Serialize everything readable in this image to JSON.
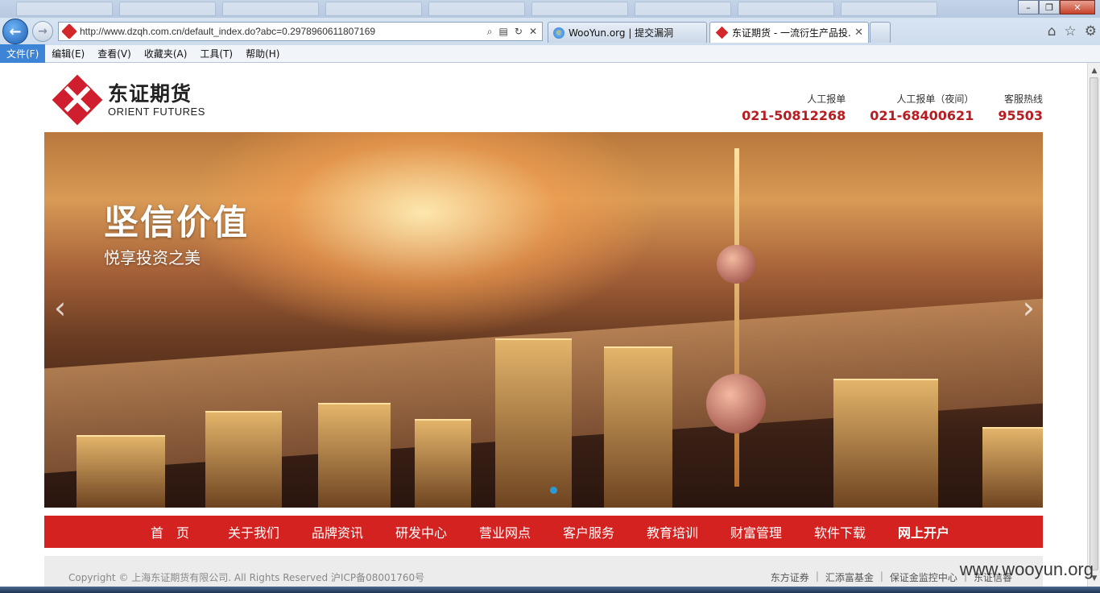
{
  "browser": {
    "url": "http://www.dzqh.com.cn/default_index.do?abc=0.2978960611807169",
    "tabs": [
      {
        "title": "WooYun.org | 提交漏洞"
      },
      {
        "title": "东证期货 - 一流衍生产品投..."
      }
    ],
    "menu": [
      "文件(F)",
      "编辑(E)",
      "查看(V)",
      "收藏夹(A)",
      "工具(T)",
      "帮助(H)"
    ]
  },
  "header": {
    "logo_cn": "东证期货",
    "logo_en": "ORIENT FUTURES",
    "hotlines": [
      {
        "label": "人工报单",
        "number": "021-50812268"
      },
      {
        "label": "人工报单（夜间）",
        "number": "021-68400621"
      },
      {
        "label": "客服热线",
        "number": "95503"
      }
    ]
  },
  "banner": {
    "title": "坚信价值",
    "subtitle": "悦享投资之美"
  },
  "nav": [
    "首　页",
    "关于我们",
    "品牌资讯",
    "研发中心",
    "营业网点",
    "客户服务",
    "教育培训",
    "财富管理",
    "软件下载",
    "网上开户"
  ],
  "footer": {
    "copyright": "Copyright © 上海东证期货有限公司. All Rights Reserved 沪ICP备08001760号",
    "links": [
      "东方证券",
      "汇添富基金",
      "保证金监控中心",
      "东证信睿"
    ]
  },
  "watermark": "www.wooyun.org",
  "colors": {
    "brand_red": "#d42220",
    "hotline_red": "#b71d20"
  }
}
